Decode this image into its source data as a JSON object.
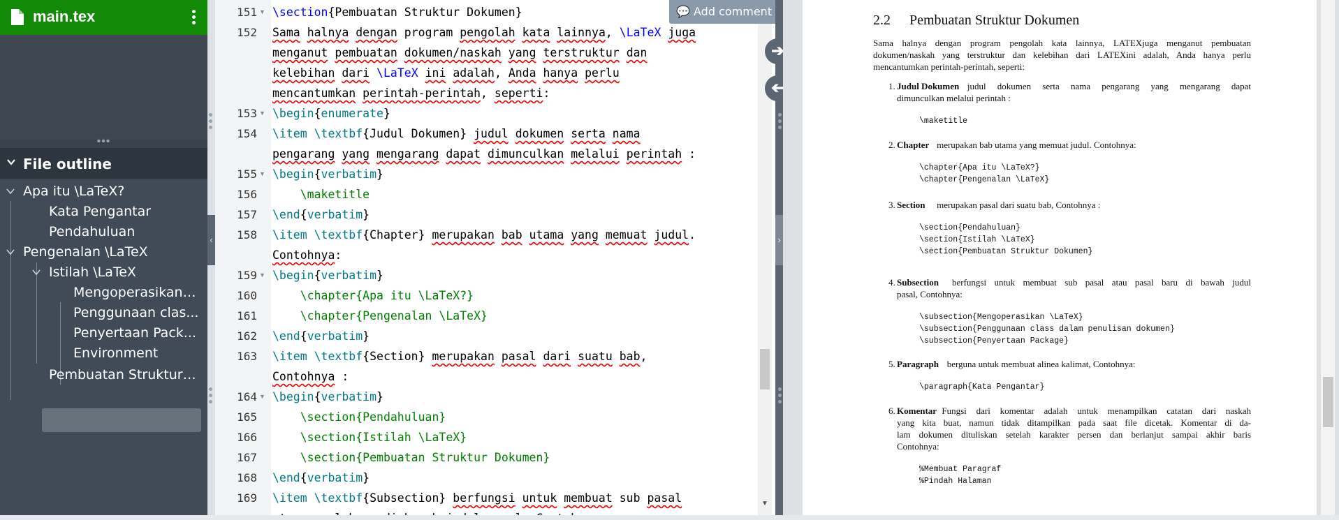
{
  "filename": "main.tex",
  "outline": {
    "header": "File outline",
    "items": [
      {
        "label": "Apa itu \\LaTeX?"
      },
      {
        "label": "Kata Pengantar"
      },
      {
        "label": "Pendahuluan"
      },
      {
        "label": "Pengenalan \\LaTeX"
      },
      {
        "label": "Istilah \\LaTeX"
      },
      {
        "label": "Mengoperasikan ..."
      },
      {
        "label": "Penggunaan clas..."
      },
      {
        "label": "Penyertaan Pack..."
      },
      {
        "label": "Environment"
      },
      {
        "label": "Pembuatan Struktur ..."
      }
    ]
  },
  "editor": {
    "add_comment": "Add comment",
    "lines": [
      {
        "n": "151",
        "fold": true,
        "p": [
          [
            "\\section",
            "kw"
          ],
          [
            "{Pembuatan Struktur Dokumen}",
            ""
          ]
        ]
      },
      {
        "n": "152",
        "p": [
          [
            "Sama",
            "sq"
          ],
          [
            " ",
            ""
          ],
          [
            "halnya",
            "sq"
          ],
          [
            " ",
            ""
          ],
          [
            "dengan",
            "sq"
          ],
          [
            " program ",
            ""
          ],
          [
            "pengolah",
            "sq"
          ],
          [
            " ",
            ""
          ],
          [
            "kata",
            "sq"
          ],
          [
            " ",
            ""
          ],
          [
            "lainnya",
            "sq"
          ],
          [
            ", ",
            ""
          ],
          [
            "\\LaTeX",
            "kw"
          ],
          [
            " ",
            ""
          ],
          [
            "juga",
            "sq"
          ]
        ]
      },
      {
        "p": [
          [
            "menganut",
            "sq"
          ],
          [
            " ",
            ""
          ],
          [
            "pembuatan",
            "sq"
          ],
          [
            " ",
            ""
          ],
          [
            "dokumen/naskah",
            "sq"
          ],
          [
            " ",
            ""
          ],
          [
            "yang",
            "sq"
          ],
          [
            " ",
            ""
          ],
          [
            "terstruktur",
            "sq"
          ],
          [
            " ",
            ""
          ],
          [
            "dan",
            "sq"
          ]
        ]
      },
      {
        "p": [
          [
            "kelebihan",
            "sq"
          ],
          [
            " ",
            ""
          ],
          [
            "dari",
            "sq"
          ],
          [
            " ",
            ""
          ],
          [
            "\\LaTeX",
            "kw"
          ],
          [
            " ",
            ""
          ],
          [
            "ini",
            "sq"
          ],
          [
            " ",
            ""
          ],
          [
            "adalah",
            "sq"
          ],
          [
            ", ",
            ""
          ],
          [
            "Anda",
            "sq"
          ],
          [
            " ",
            ""
          ],
          [
            "hanya",
            "sq"
          ],
          [
            " ",
            ""
          ],
          [
            "perlu",
            "sq"
          ]
        ]
      },
      {
        "p": [
          [
            "mencantumkan",
            "sq"
          ],
          [
            " ",
            ""
          ],
          [
            "perintah-perintah",
            "sq"
          ],
          [
            ", ",
            ""
          ],
          [
            "seperti",
            "sq"
          ],
          [
            ":",
            ""
          ]
        ]
      },
      {
        "n": "153",
        "fold": true,
        "p": [
          [
            "\\begin",
            "fn"
          ],
          [
            "{",
            ""
          ],
          [
            "enumerate",
            "fn"
          ],
          [
            "}",
            ""
          ]
        ]
      },
      {
        "n": "154",
        "p": [
          [
            "\\item \\textbf",
            "fn"
          ],
          [
            "{Judul Dokumen} ",
            ""
          ],
          [
            "judul",
            "sq"
          ],
          [
            " ",
            ""
          ],
          [
            "dokumen",
            "sq"
          ],
          [
            " ",
            ""
          ],
          [
            "serta",
            "sq"
          ],
          [
            " ",
            ""
          ],
          [
            "nama",
            "sq"
          ]
        ]
      },
      {
        "p": [
          [
            "pengarang",
            "sq"
          ],
          [
            " ",
            ""
          ],
          [
            "yang",
            "sq"
          ],
          [
            " ",
            ""
          ],
          [
            "mengarang",
            "sq"
          ],
          [
            " ",
            ""
          ],
          [
            "dapat",
            "sq"
          ],
          [
            " ",
            ""
          ],
          [
            "dimunculkan",
            "sq"
          ],
          [
            " ",
            ""
          ],
          [
            "melalui",
            "sq"
          ],
          [
            " ",
            ""
          ],
          [
            "perintah",
            "sq"
          ],
          [
            " :",
            ""
          ]
        ]
      },
      {
        "n": "155",
        "fold": true,
        "p": [
          [
            "\\begin",
            "fn"
          ],
          [
            "{",
            ""
          ],
          [
            "verbatim",
            "fn"
          ],
          [
            "}",
            ""
          ]
        ]
      },
      {
        "n": "156",
        "p": [
          [
            "    \\maketitle",
            "ar"
          ]
        ]
      },
      {
        "n": "157",
        "p": [
          [
            "\\end",
            "fn"
          ],
          [
            "{",
            ""
          ],
          [
            "verbatim",
            "fn"
          ],
          [
            "}",
            ""
          ]
        ]
      },
      {
        "n": "158",
        "p": [
          [
            "\\item \\textbf",
            "fn"
          ],
          [
            "{Chapter} ",
            ""
          ],
          [
            "merupakan",
            "sq"
          ],
          [
            " ",
            ""
          ],
          [
            "bab",
            "sq"
          ],
          [
            " ",
            ""
          ],
          [
            "utama",
            "sq"
          ],
          [
            " ",
            ""
          ],
          [
            "yang",
            "sq"
          ],
          [
            " ",
            ""
          ],
          [
            "memuat",
            "sq"
          ],
          [
            " ",
            ""
          ],
          [
            "judul",
            "sq"
          ],
          [
            ".",
            ""
          ]
        ]
      },
      {
        "p": [
          [
            "Contohnya",
            "sq"
          ],
          [
            ":",
            ""
          ]
        ]
      },
      {
        "n": "159",
        "fold": true,
        "p": [
          [
            "\\begin",
            "fn"
          ],
          [
            "{",
            ""
          ],
          [
            "verbatim",
            "fn"
          ],
          [
            "}",
            ""
          ]
        ]
      },
      {
        "n": "160",
        "p": [
          [
            "    \\chapter{Apa itu \\LaTeX?}",
            "ar"
          ]
        ]
      },
      {
        "n": "161",
        "p": [
          [
            "    \\chapter{Pengenalan \\LaTeX}",
            "ar"
          ]
        ]
      },
      {
        "n": "162",
        "p": [
          [
            "\\end",
            "fn"
          ],
          [
            "{",
            ""
          ],
          [
            "verbatim",
            "fn"
          ],
          [
            "}",
            ""
          ]
        ]
      },
      {
        "n": "163",
        "p": [
          [
            "\\item \\textbf",
            "fn"
          ],
          [
            "{Section} ",
            ""
          ],
          [
            "merupakan",
            "sq"
          ],
          [
            " ",
            ""
          ],
          [
            "pasal",
            "sq"
          ],
          [
            " ",
            ""
          ],
          [
            "dari",
            "sq"
          ],
          [
            " ",
            ""
          ],
          [
            "suatu",
            "sq"
          ],
          [
            " ",
            ""
          ],
          [
            "bab",
            "sq"
          ],
          [
            ",",
            ""
          ]
        ]
      },
      {
        "p": [
          [
            "Contohnya",
            "sq"
          ],
          [
            " :",
            ""
          ]
        ]
      },
      {
        "n": "164",
        "fold": true,
        "p": [
          [
            "\\begin",
            "fn"
          ],
          [
            "{",
            ""
          ],
          [
            "verbatim",
            "fn"
          ],
          [
            "}",
            ""
          ]
        ]
      },
      {
        "n": "165",
        "p": [
          [
            "    \\section{Pendahuluan}",
            "ar"
          ]
        ]
      },
      {
        "n": "166",
        "p": [
          [
            "    \\section{Istilah \\LaTeX}",
            "ar"
          ]
        ]
      },
      {
        "n": "167",
        "p": [
          [
            "    \\section{Pembuatan Struktur Dokumen}",
            "ar"
          ]
        ]
      },
      {
        "n": "168",
        "p": [
          [
            "\\end",
            "fn"
          ],
          [
            "{",
            ""
          ],
          [
            "verbatim",
            "fn"
          ],
          [
            "}",
            ""
          ]
        ]
      },
      {
        "n": "169",
        "p": [
          [
            "\\item \\textbf",
            "fn"
          ],
          [
            "{Subsection} ",
            ""
          ],
          [
            "berfungsi",
            "sq"
          ],
          [
            " ",
            ""
          ],
          [
            "untuk",
            "sq"
          ],
          [
            " ",
            ""
          ],
          [
            "membuat",
            "sq"
          ],
          [
            " sub ",
            ""
          ],
          [
            "pasal",
            "sq"
          ]
        ]
      },
      {
        "p": [
          [
            "atau pasal baru di bawah judul pasal, Contohnya:",
            ""
          ]
        ]
      }
    ]
  },
  "pdf": {
    "section_num": "2.2",
    "section_title": "Pembuatan Struktur Dokumen",
    "intro": [
      "Sama halnya dengan program pengolah kata lainnya, LATEXjuga menganut pembuatan",
      "dokumen/naskah yang terstruktur dan kelebihan dari LATEXini adalah, Anda hanya perlu",
      "mencantumkan perintah-perintah, seperti:"
    ],
    "items": [
      {
        "num": "1.",
        "bold": "Judul Dokumen",
        "lines": [
          "judul dokumen serta nama pengarang yang mengarang dapat",
          "dimunculkan melalui perintah :"
        ],
        "code": [
          "\\maketitle"
        ]
      },
      {
        "num": "2.",
        "bold": "Chapter",
        "lines": [
          "merupakan bab utama yang memuat judul. Contohnya:"
        ],
        "code": [
          "\\chapter{Apa itu \\LaTeX?}",
          "\\chapter{Pengenalan \\LaTeX}"
        ]
      },
      {
        "num": "3.",
        "bold": "Section",
        "lines": [
          "merupakan pasal dari suatu bab, Contohnya :"
        ],
        "code": [
          "\\section{Pendahuluan}",
          "\\section{Istilah \\LaTeX}",
          "\\section{Pembuatan Struktur Dokumen}"
        ]
      },
      {
        "num": "4.",
        "bold": "Subsection",
        "lines": [
          "berfungsi untuk membuat sub pasal atau pasal baru di bawah judul",
          "pasal, Contohnya:"
        ],
        "code": [
          "\\subsection{Mengoperasikan \\LaTeX}",
          "\\subsection{Penggunaan class dalam penulisan dokumen}",
          "\\subsection{Penyertaan Package}"
        ]
      },
      {
        "num": "5.",
        "bold": "Paragraph",
        "lines": [
          "berguna untuk membuat alinea kalimat, Contohnya:"
        ],
        "code": [
          "\\paragraph{Kata Pengantar}"
        ]
      },
      {
        "num": "6.",
        "bold": "Komentar",
        "lines": [
          "Fungsi dari komentar adalah untuk menampilkan catatan dari naskah",
          "yang kita buat, namun tidak ditampilkan pada saat file dicetak. Komentar di da-",
          "lam dokumen dituliskan setelah karakter persen dan berlanjut sampai akhir baris",
          "Contohnya:"
        ],
        "code": [
          "%Membuat Paragraf",
          "%Pindah Halaman"
        ]
      }
    ]
  }
}
